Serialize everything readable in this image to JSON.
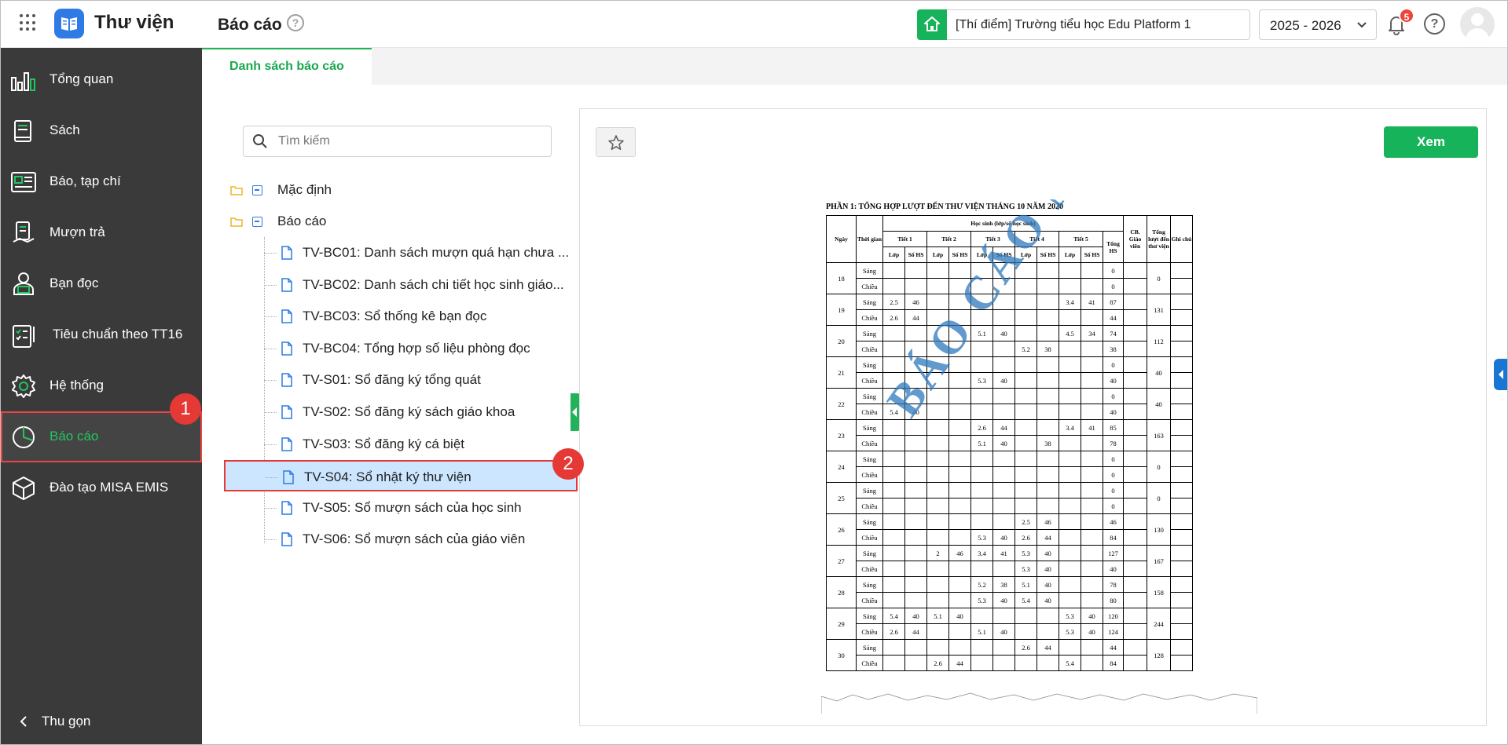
{
  "header": {
    "app_title": "Thư viện",
    "page_title": "Báo cáo",
    "help_symbol": "?",
    "school": "[Thí điểm] Trường tiểu học Edu Platform 1",
    "year": "2025 - 2026",
    "notification_count": "5",
    "icons": [
      "apps-grid-icon",
      "library-logo-icon",
      "help-icon",
      "home-icon",
      "chevron-down-icon",
      "bell-icon",
      "avatar-icon"
    ]
  },
  "sidebar": {
    "items": [
      {
        "label": "Tổng quan",
        "icon": "chart-icon"
      },
      {
        "label": "Sách",
        "icon": "book-icon"
      },
      {
        "label": "Báo, tạp chí",
        "icon": "newspaper-icon"
      },
      {
        "label": "Mượn trả",
        "icon": "borrow-icon"
      },
      {
        "label": "Bạn đọc",
        "icon": "reader-icon"
      },
      {
        "label": "Tiêu chuẩn theo TT16",
        "icon": "checklist-icon"
      },
      {
        "label": "Hệ thống",
        "icon": "gear-icon"
      },
      {
        "label": "Báo cáo",
        "icon": "pie-chart-icon",
        "active": true
      },
      {
        "label": "Đào tạo MISA EMIS",
        "icon": "cube-icon"
      }
    ],
    "collapse_label": "Thu gọn"
  },
  "steps": [
    "1",
    "2"
  ],
  "tabs": [
    {
      "label": "Danh sách báo cáo",
      "active": true
    }
  ],
  "search": {
    "placeholder": "Tìm kiếm"
  },
  "tree": {
    "folders": [
      {
        "label": "Mặc định"
      },
      {
        "label": "Báo cáo"
      }
    ],
    "reports": [
      "TV-BC01: Danh sách mượn quá hạn chưa ...",
      "TV-BC02: Danh sách chi tiết học sinh giáo...",
      "TV-BC03: Sổ thống kê bạn đọc",
      "TV-BC04: Tổng hợp số liệu phòng đọc",
      "TV-S01: Sổ đăng ký tổng quát",
      "TV-S02: Sổ đăng ký sách giáo khoa",
      "TV-S03: Sổ đăng ký cá biệt",
      "TV-S04: Sổ nhật ký thư viện",
      "TV-S05: Sổ mượn sách của học sinh",
      "TV-S06: Sổ mượn sách của giáo viên"
    ],
    "selected_index": 7
  },
  "preview": {
    "view_button": "Xem",
    "sheet_title": "PHẦN 1: TỔNG HỢP LƯỢT ĐẾN THƯ VIỆN THÁNG 10 NĂM 2020",
    "watermark": "BÁO CÁO MẪU",
    "headers": {
      "ngay": "Ngày",
      "thoi_gian": "Thời gian",
      "hoc_sinh": "Học sinh (lớp/số học sinh)",
      "tiet": [
        "Tiết 1",
        "Tiết 2",
        "Tiết 3",
        "Tiết 4",
        "Tiết 5"
      ],
      "lop": "Lớp",
      "so_hs": "Số HS",
      "tong_hs": "Tổng HS",
      "cb_gv": "CB. Giáo viên",
      "tong_luot": "Tổng lượt đến thư viện",
      "ghi_chu": "Ghi chú"
    },
    "rows": [
      {
        "day": "18",
        "total": "0",
        "sessions": [
          {
            "label": "Sáng",
            "cells": [
              "",
              "",
              "",
              "",
              "",
              "",
              "",
              "",
              "",
              ""
            ],
            "hs": "0"
          },
          {
            "label": "Chiều",
            "cells": [
              "",
              "",
              "",
              "",
              "",
              "",
              "",
              "",
              "",
              ""
            ],
            "hs": "0"
          }
        ]
      },
      {
        "day": "19",
        "total": "131",
        "sessions": [
          {
            "label": "Sáng",
            "cells": [
              "2.5",
              "46",
              "",
              "",
              "",
              "",
              "",
              "",
              "3.4",
              "41"
            ],
            "hs": "87"
          },
          {
            "label": "Chiều",
            "cells": [
              "2.6",
              "44",
              "",
              "",
              "",
              "",
              "",
              "",
              "",
              ""
            ],
            "hs": "44"
          }
        ]
      },
      {
        "day": "20",
        "total": "112",
        "sessions": [
          {
            "label": "Sáng",
            "cells": [
              "",
              "",
              "",
              "",
              "5.1",
              "40",
              "",
              "",
              "4.5",
              "34"
            ],
            "hs": "74"
          },
          {
            "label": "Chiều",
            "cells": [
              "",
              "",
              "",
              "",
              "",
              "",
              "5.2",
              "38",
              "",
              ""
            ],
            "hs": "38"
          }
        ]
      },
      {
        "day": "21",
        "total": "40",
        "sessions": [
          {
            "label": "Sáng",
            "cells": [
              "",
              "",
              "",
              "",
              "",
              "",
              "",
              "",
              "",
              ""
            ],
            "hs": "0"
          },
          {
            "label": "Chiều",
            "cells": [
              "",
              "",
              "",
              "",
              "5.3",
              "40",
              "",
              "",
              "",
              ""
            ],
            "hs": "40"
          }
        ]
      },
      {
        "day": "22",
        "total": "40",
        "sessions": [
          {
            "label": "Sáng",
            "cells": [
              "",
              "",
              "",
              "",
              "",
              "",
              "",
              "",
              "",
              ""
            ],
            "hs": "0"
          },
          {
            "label": "Chiều",
            "cells": [
              "5.4",
              "40",
              "",
              "",
              "",
              "",
              "",
              "",
              "",
              ""
            ],
            "hs": "40"
          }
        ]
      },
      {
        "day": "23",
        "total": "163",
        "sessions": [
          {
            "label": "Sáng",
            "cells": [
              "",
              "",
              "",
              "",
              "2.6",
              "44",
              "",
              "",
              "3.4",
              "41"
            ],
            "hs": "85"
          },
          {
            "label": "Chiều",
            "cells": [
              "",
              "",
              "",
              "",
              "5.1",
              "40",
              "",
              "38",
              "",
              ""
            ],
            "hs": "78"
          }
        ]
      },
      {
        "day": "24",
        "total": "0",
        "sessions": [
          {
            "label": "Sáng",
            "cells": [
              "",
              "",
              "",
              "",
              "",
              "",
              "",
              "",
              "",
              ""
            ],
            "hs": "0"
          },
          {
            "label": "Chiều",
            "cells": [
              "",
              "",
              "",
              "",
              "",
              "",
              "",
              "",
              "",
              ""
            ],
            "hs": "0"
          }
        ]
      },
      {
        "day": "25",
        "total": "0",
        "sessions": [
          {
            "label": "Sáng",
            "cells": [
              "",
              "",
              "",
              "",
              "",
              "",
              "",
              "",
              "",
              ""
            ],
            "hs": "0"
          },
          {
            "label": "Chiều",
            "cells": [
              "",
              "",
              "",
              "",
              "",
              "",
              "",
              "",
              "",
              ""
            ],
            "hs": "0"
          }
        ]
      },
      {
        "day": "26",
        "total": "130",
        "sessions": [
          {
            "label": "Sáng",
            "cells": [
              "",
              "",
              "",
              "",
              "",
              "",
              "2.5",
              "46",
              "",
              ""
            ],
            "hs": "46"
          },
          {
            "label": "Chiều",
            "cells": [
              "",
              "",
              "",
              "",
              "5.3",
              "40",
              "2.6",
              "44",
              "",
              ""
            ],
            "hs": "84"
          }
        ]
      },
      {
        "day": "27",
        "total": "167",
        "sessions": [
          {
            "label": "Sáng",
            "cells": [
              "",
              "",
              "2",
              "46",
              "3.4",
              "41",
              "5.3",
              "40",
              "",
              ""
            ],
            "hs": "127"
          },
          {
            "label": "Chiều",
            "cells": [
              "",
              "",
              "",
              "",
              "",
              "",
              "5.3",
              "40",
              "",
              ""
            ],
            "hs": "40"
          }
        ]
      },
      {
        "day": "28",
        "total": "158",
        "sessions": [
          {
            "label": "Sáng",
            "cells": [
              "",
              "",
              "",
              "",
              "5.2",
              "38",
              "5.1",
              "40",
              "",
              ""
            ],
            "hs": "78"
          },
          {
            "label": "Chiều",
            "cells": [
              "",
              "",
              "",
              "",
              "5.3",
              "40",
              "5.4",
              "40",
              "",
              ""
            ],
            "hs": "80"
          }
        ]
      },
      {
        "day": "29",
        "total": "244",
        "sessions": [
          {
            "label": "Sáng",
            "cells": [
              "5.4",
              "40",
              "5.1",
              "40",
              "",
              "",
              "",
              "",
              "5.3",
              "40"
            ],
            "hs": "120"
          },
          {
            "label": "Chiều",
            "cells": [
              "2.6",
              "44",
              "",
              "",
              "5.1",
              "40",
              "",
              "",
              "5.3",
              "40"
            ],
            "hs": "124"
          }
        ]
      },
      {
        "day": "30",
        "total": "128",
        "sessions": [
          {
            "label": "Sáng",
            "cells": [
              "",
              "",
              "",
              "",
              "",
              "",
              "2.6",
              "44",
              "",
              ""
            ],
            "hs": "44"
          },
          {
            "label": "Chiều",
            "cells": [
              "",
              "",
              "2.6",
              "44",
              "",
              "",
              "",
              "",
              "5.4",
              ""
            ],
            "hs": "84"
          }
        ]
      }
    ]
  }
}
